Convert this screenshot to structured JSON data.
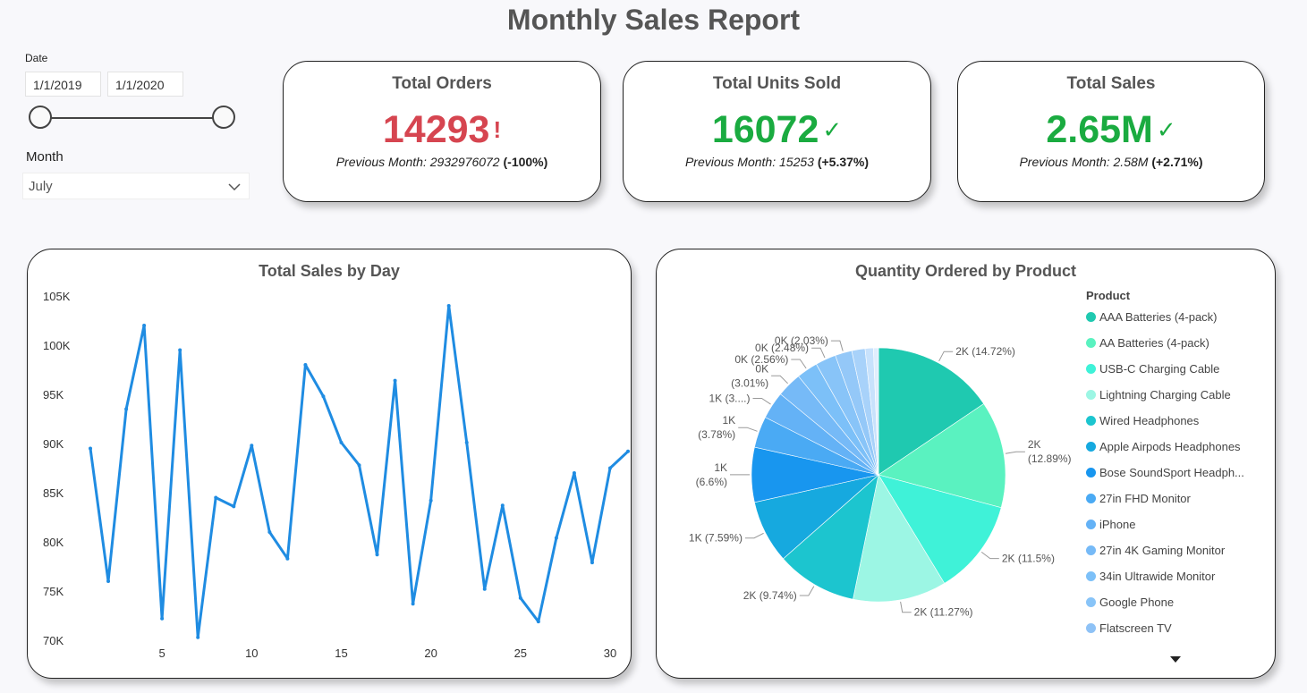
{
  "report_title": "Monthly Sales Report",
  "slicers": {
    "date_label": "Date",
    "date_start": "1/1/2019",
    "date_end": "1/1/2020",
    "month_label": "Month",
    "month_value": "July",
    "chevron_icon": "chevron-down-icon"
  },
  "kpis": [
    {
      "title": "Total Orders",
      "value": "14293",
      "indicator": "!",
      "status_color": "#d64550",
      "prev_text": "Previous Month: 2932976072",
      "change": "(-100%)"
    },
    {
      "title": "Total Units Sold",
      "value": "16072",
      "indicator": "✓",
      "status_color": "#1aab40",
      "prev_text": "Previous Month: 15253",
      "change": "(+5.37%)"
    },
    {
      "title": "Total Sales",
      "value": "2.65M",
      "indicator": "✓",
      "status_color": "#1aab40",
      "prev_text": "Previous Month: 2.58M",
      "change": "(+2.71%)"
    }
  ],
  "chart_data": [
    {
      "type": "line",
      "title": "Total Sales by Day",
      "x": [
        1,
        2,
        3,
        4,
        5,
        6,
        7,
        8,
        9,
        10,
        11,
        12,
        13,
        14,
        15,
        16,
        17,
        18,
        19,
        20,
        21,
        22,
        23,
        24,
        25,
        26,
        27,
        28,
        29,
        30,
        31
      ],
      "values": [
        89500,
        76000,
        93500,
        102000,
        72200,
        99500,
        70300,
        84500,
        83600,
        89800,
        81000,
        78300,
        98000,
        94800,
        90100,
        87800,
        78700,
        96400,
        73700,
        84200,
        104000,
        90100,
        75200,
        83700,
        74300,
        71900,
        80400,
        87000,
        77900,
        87500,
        89200
      ],
      "y_ticks": [
        "105K",
        "100K",
        "95K",
        "90K",
        "85K",
        "80K",
        "75K",
        "70K"
      ],
      "x_ticks": [
        "5",
        "10",
        "15",
        "20",
        "25",
        "30"
      ],
      "ylim": [
        70000,
        105000
      ],
      "color": "#1f8ce2"
    },
    {
      "type": "pie",
      "title": "Quantity Ordered by Product",
      "legend_title": "Product",
      "legend": [
        {
          "name": "AAA Batteries (4-pack)",
          "color": "#1fc9b0"
        },
        {
          "name": "AA Batteries (4-pack)",
          "color": "#5af2c0"
        },
        {
          "name": "USB-C Charging Cable",
          "color": "#3ff2d8"
        },
        {
          "name": "Lightning Charging Cable",
          "color": "#9cf6e4"
        },
        {
          "name": "Wired Headphones",
          "color": "#1cc5cf"
        },
        {
          "name": "Apple Airpods Headphones",
          "color": "#16a9df"
        },
        {
          "name": "Bose SoundSport Headph...",
          "color": "#1896ef"
        },
        {
          "name": "27in FHD Monitor",
          "color": "#4aaaf4"
        },
        {
          "name": "iPhone",
          "color": "#64b2f6"
        },
        {
          "name": "27in 4K Gaming Monitor",
          "color": "#76baf7"
        },
        {
          "name": "34in Ultrawide Monitor",
          "color": "#7cc0f8"
        },
        {
          "name": "Google Phone",
          "color": "#88c4f8"
        },
        {
          "name": "Flatscreen TV",
          "color": "#8ec2f6"
        }
      ],
      "legend_more_icon": "triangle-down-icon",
      "slices": [
        {
          "percent": 14.72,
          "label": "2K (14.72%)",
          "color": "#1fc9b0"
        },
        {
          "percent": 12.89,
          "label": "2K\n(12.89%)",
          "color": "#5af2c0"
        },
        {
          "percent": 11.5,
          "label": "2K (11.5%)",
          "color": "#3ff2d8"
        },
        {
          "percent": 11.27,
          "label": "2K (11.27%)",
          "color": "#9cf6e4"
        },
        {
          "percent": 9.74,
          "label": "2K (9.74%)",
          "color": "#1cc5cf"
        },
        {
          "percent": 7.59,
          "label": "1K (7.59%)",
          "color": "#16a9df"
        },
        {
          "percent": 6.6,
          "label": "1K\n(6.6%)",
          "color": "#1896ef"
        },
        {
          "percent": 3.78,
          "label": "1K\n(3.78%)",
          "color": "#4aaaf4"
        },
        {
          "percent": 3.3,
          "label": "1K (3....)",
          "color": "#64b2f6"
        },
        {
          "percent": 3.01,
          "label": "0K\n(3.01%)",
          "color": "#76baf7"
        },
        {
          "percent": 2.56,
          "label": "0K (2.56%)",
          "color": "#7cc0f8"
        },
        {
          "percent": 2.48,
          "label": "0K (2.48%)",
          "color": "#88c4f8"
        },
        {
          "percent": 2.03,
          "label": "0K (2.03%)",
          "color": "#94c8f8"
        },
        {
          "percent": 1.6,
          "label": "",
          "color": "#a8d2fa"
        },
        {
          "percent": 1.0,
          "label": "",
          "color": "#c8e2fc"
        },
        {
          "percent": 0.6,
          "label": "",
          "color": "#e0eefd"
        }
      ]
    }
  ]
}
